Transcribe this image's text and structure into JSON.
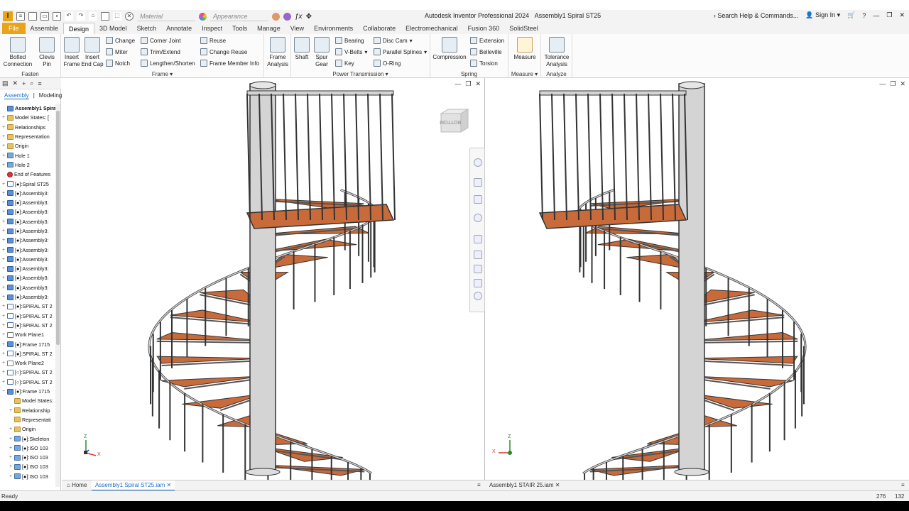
{
  "app": {
    "title": "Autodesk Inventor Professional 2024",
    "document": "Assembly1 Spiral  ST25",
    "logo": "I"
  },
  "quickaccess": {
    "material": "Material",
    "appearance": "Appearance"
  },
  "titlebar_right": {
    "search": "Search Help & Commands...",
    "signin": "Sign In"
  },
  "tabs": [
    "File",
    "Assemble",
    "Design",
    "3D Model",
    "Sketch",
    "Annotate",
    "Inspect",
    "Tools",
    "Manage",
    "View",
    "Environments",
    "Collaborate",
    "Electromechanical",
    "Fusion 360",
    "SolidSteel"
  ],
  "active_tab": "Design",
  "ribbon": {
    "fasten": {
      "title": "Fasten",
      "bolted": "Bolted\nConnection",
      "clevis": "Clevis\nPin"
    },
    "frame": {
      "title": "Frame",
      "insert_frame": "Insert\nFrame",
      "insert_endcap": "Insert\nEnd Cap",
      "change": "Change",
      "miter": "Miter",
      "notch": "Notch",
      "corner_joint": "Corner Joint",
      "trim_extend": "Trim/Extend",
      "lengthen": "Lengthen/Shorten",
      "reuse": "Reuse",
      "change_reuse": "Change Reuse",
      "member_info": "Frame Member Info"
    },
    "frame_analysis": "Frame\nAnalysis",
    "power": {
      "title": "Power Transmission",
      "shaft": "Shaft",
      "spur": "Spur\nGear",
      "bearing": "Bearing",
      "vbelts": "V-Belts",
      "key": "Key",
      "disc_cam": "Disc Cam",
      "parallel_splines": "Parallel Splines",
      "oring": "O-Ring"
    },
    "spring": {
      "title": "Spring",
      "compression": "Compression",
      "extension": "Extension",
      "belleville": "Belleville",
      "torsion": "Torsion"
    },
    "measure": {
      "title": "Measure",
      "label": "Measure"
    },
    "analyze": {
      "title": "Analyze",
      "label": "Tolerance\nAnalysis"
    }
  },
  "browser": {
    "modes": [
      "Assembly",
      "Modeling"
    ],
    "items": [
      {
        "label": "Assembly1 Spiral",
        "icon": "asm",
        "ex": "",
        "bold": true
      },
      {
        "label": "Model States: [",
        "icon": "folder",
        "ex": "+"
      },
      {
        "label": "Relationships",
        "icon": "folder",
        "ex": "+"
      },
      {
        "label": "Representation",
        "icon": "folder",
        "ex": "+"
      },
      {
        "label": "Origin",
        "icon": "folder",
        "ex": "+"
      },
      {
        "label": "Hole 1",
        "icon": "part",
        "ex": "+"
      },
      {
        "label": "Hole 2",
        "icon": "part",
        "ex": "+"
      },
      {
        "label": "End of Features",
        "icon": "err",
        "ex": ""
      },
      {
        "label": "[●]:Spiral  ST25",
        "icon": "spr",
        "ex": "+"
      },
      {
        "label": "[●]:Assembly3:",
        "icon": "asm",
        "ex": "+"
      },
      {
        "label": "[●]:Assembly3:",
        "icon": "asm",
        "ex": "+"
      },
      {
        "label": "[●]:Assembly3:",
        "icon": "asm",
        "ex": "+"
      },
      {
        "label": "[●]:Assembly3:",
        "icon": "asm",
        "ex": "+"
      },
      {
        "label": "[●]:Assembly3:",
        "icon": "asm",
        "ex": "+"
      },
      {
        "label": "[●]:Assembly3:",
        "icon": "asm",
        "ex": "+"
      },
      {
        "label": "[●]:Assembly3:",
        "icon": "asm",
        "ex": "+"
      },
      {
        "label": "[●]:Assembly3:",
        "icon": "asm",
        "ex": "+"
      },
      {
        "label": "[●]:Assembly3:",
        "icon": "asm",
        "ex": "+"
      },
      {
        "label": "[●]:Assembly3:",
        "icon": "asm",
        "ex": "+"
      },
      {
        "label": "[●]:Assembly3:",
        "icon": "asm",
        "ex": "+"
      },
      {
        "label": "[●]:Assembly3:",
        "icon": "asm",
        "ex": "+"
      },
      {
        "label": "[●]:SPIRAL ST 2",
        "icon": "spr",
        "ex": "+"
      },
      {
        "label": "[●]:SPIRAL ST 2",
        "icon": "spr",
        "ex": "+"
      },
      {
        "label": "[●]:SPIRAL ST 2",
        "icon": "spr",
        "ex": "+"
      },
      {
        "label": "Work Plane1",
        "icon": "wp",
        "ex": "+"
      },
      {
        "label": "[●]:Frame 1715",
        "icon": "asm",
        "ex": "+"
      },
      {
        "label": "[●]:SPIRAL ST 2",
        "icon": "spr",
        "ex": "+"
      },
      {
        "label": "Work Plane2",
        "icon": "wp",
        "ex": "+"
      },
      {
        "label": "[○]:SPIRAL ST 2",
        "icon": "spr",
        "ex": "+"
      },
      {
        "label": "[○]:SPIRAL ST 2",
        "icon": "spr",
        "ex": "+"
      },
      {
        "label": "[●]:Frame 1715",
        "icon": "asm",
        "ex": "−"
      },
      {
        "label": "Model States:",
        "icon": "folder",
        "ex": "",
        "indent": 1
      },
      {
        "label": "Relationship",
        "icon": "folder",
        "ex": "+",
        "indent": 1
      },
      {
        "label": "Representati",
        "icon": "folder",
        "ex": "",
        "indent": 1
      },
      {
        "label": "Origin",
        "icon": "folder",
        "ex": "+",
        "indent": 1
      },
      {
        "label": "[●]:Skeleton",
        "icon": "part",
        "ex": "+",
        "indent": 1
      },
      {
        "label": "[●]:ISO 103",
        "icon": "part",
        "ex": "+",
        "indent": 1
      },
      {
        "label": "[●]:ISO 103",
        "icon": "part",
        "ex": "+",
        "indent": 1
      },
      {
        "label": "[●]:ISO 103",
        "icon": "part",
        "ex": "+",
        "indent": 1
      },
      {
        "label": "[●]:ISO 103",
        "icon": "part",
        "ex": "+",
        "indent": 1
      }
    ]
  },
  "viewcube_label": "BOTTOM",
  "triad": {
    "z": "Z",
    "x": "X"
  },
  "doctabs": {
    "home": "Home",
    "left": "Assembly1 Spiral  ST25.iam",
    "right": "Assembly1 STAIR 25.iam"
  },
  "status": {
    "text": "Ready",
    "n1": "276",
    "n2": "132"
  },
  "colors": {
    "tread": "#c96a3a",
    "steel": "#d4d4d4",
    "accent": "#e8a317"
  }
}
